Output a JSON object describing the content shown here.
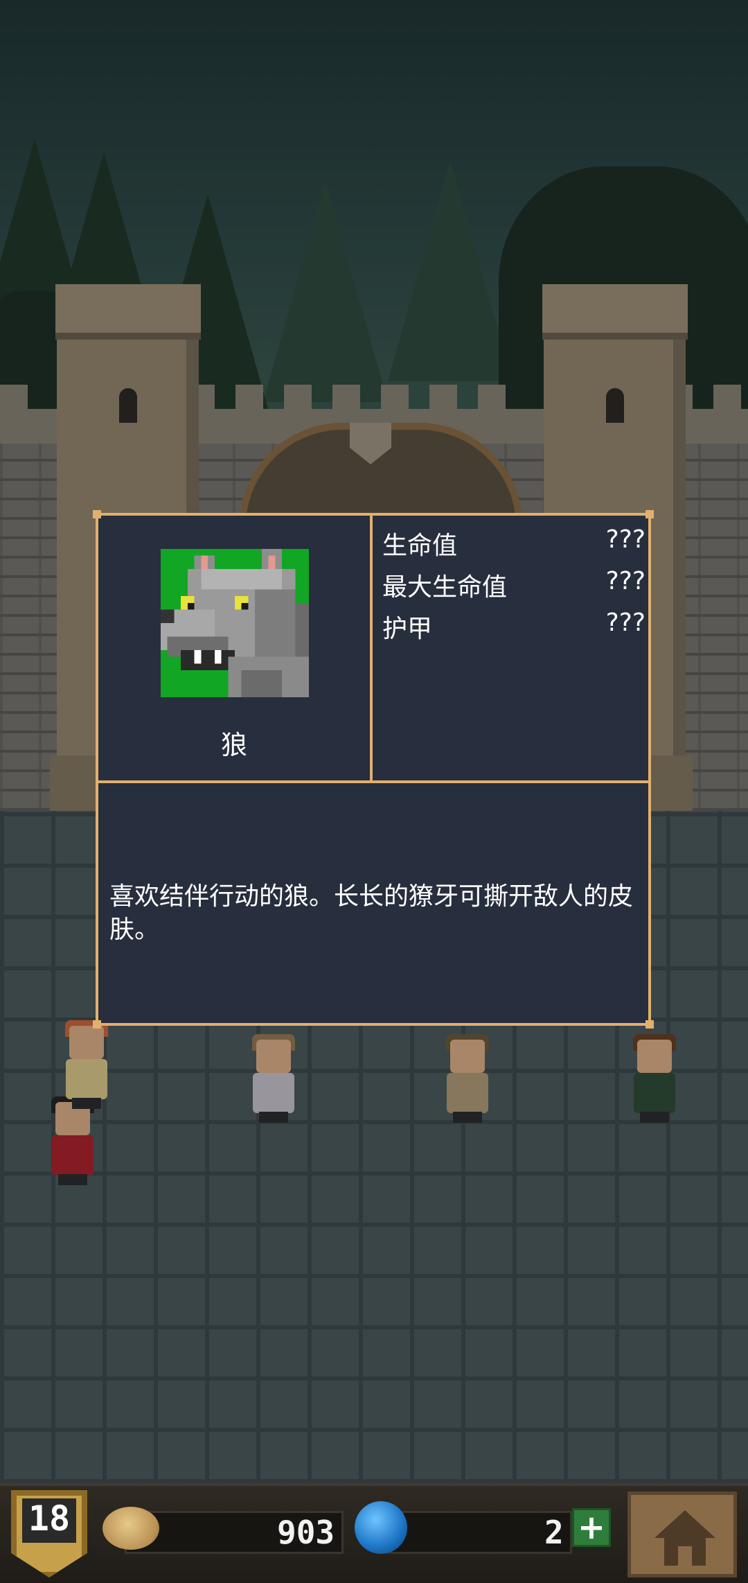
{
  "dialog": {
    "creature_name": "狼",
    "portrait_icon": "wolf-portrait-icon",
    "stats": [
      {
        "label": "生命值",
        "value": "???"
      },
      {
        "label": "最大生命值",
        "value": "???"
      },
      {
        "label": "护甲",
        "value": "???"
      }
    ],
    "description": "喜欢结伴行动的狼。长长的獠牙可撕开敌人的皮肤。"
  },
  "bottom_bar": {
    "level": "18",
    "coins": "903",
    "gems": "2",
    "coin_icon": "coin-icon",
    "gem_icon": "gem-icon",
    "plus_icon": "plus-icon",
    "home_icon": "home-icon"
  },
  "colors": {
    "panel_bg": "#272e3d",
    "panel_border": "#e2b06e",
    "portrait_bg": "#11a623"
  }
}
